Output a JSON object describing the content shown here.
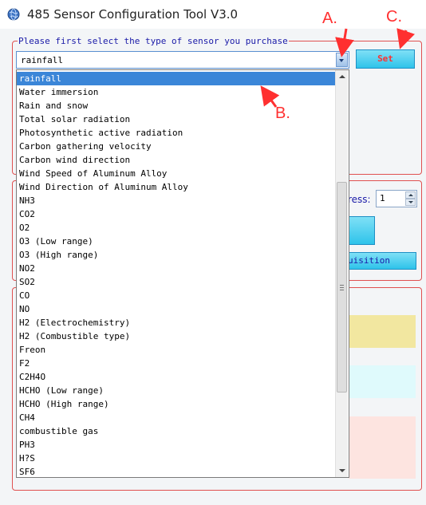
{
  "window": {
    "title": "485 Sensor Configuration Tool V3.0",
    "icon": "globe-icon"
  },
  "sensor_group": {
    "legend": "Please first select the type of sensor you purchase",
    "selected_value": "rainfall",
    "set_label": "Set"
  },
  "address": {
    "label": "ress:",
    "value": "1"
  },
  "acquisition_label": "uisition",
  "dropdown": {
    "items": [
      "rainfall",
      "Water immersion",
      "Rain and snow",
      "Total solar radiation",
      "Photosynthetic active radiation",
      "Carbon gathering velocity",
      "Carbon wind direction",
      "Wind Speed of Aluminum Alloy",
      "Wind Direction of Aluminum Alloy",
      "NH3",
      "CO2",
      "O2",
      "O3 (Low range)",
      "O3 (High range)",
      "NO2",
      "SO2",
      "CO",
      "NO",
      "H2 (Electrochemistry)",
      "H2 (Combustible type)",
      "Freon",
      "F2",
      "C2H4O",
      "HCHO (Low range)",
      "HCHO (High range)",
      "CH4",
      "combustible gas",
      "PH3",
      "H?S",
      "SF6"
    ],
    "selected_index": 0
  },
  "annotations": {
    "a": "A.",
    "b": "B.",
    "c": "C."
  },
  "colors": {
    "annotation": "#ff3030",
    "selection": "#3b86d8",
    "frame": "#e05050",
    "legend_text": "#1a1aa8"
  }
}
